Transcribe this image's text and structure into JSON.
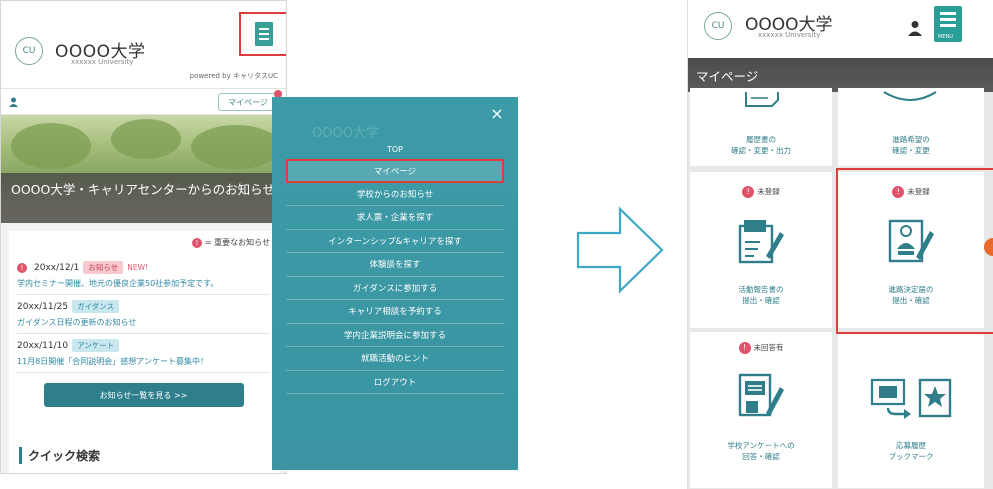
{
  "left": {
    "logo_mark": "CU",
    "university_name": "OOOO大学",
    "university_sub": "xxxxxx University",
    "powered_by": "powered by キャリタスUC",
    "mypage_button": "マイページ",
    "hero_title": "OOOO大学・キャリアセンターからのお知らせ",
    "legend": "= 重要なお知らせ",
    "news": [
      {
        "date": "20xx/12/1",
        "tag": "お知らせ",
        "tag_type": "notice",
        "new": "NEW!",
        "important": true,
        "title": "学内セミナー開催、地元の優良企業50社参加予定です。"
      },
      {
        "date": "20xx/11/25",
        "tag": "ガイダンス",
        "tag_type": "guide",
        "new": "",
        "important": false,
        "title": "ガイダンス日程の更新のお知らせ"
      },
      {
        "date": "20xx/11/10",
        "tag": "アンケート",
        "tag_type": "survey",
        "new": "",
        "important": false,
        "title": "11月8日開催「合同説明会」感想アンケート募集中！"
      }
    ],
    "more_button": "お知らせ一覧を見る >>",
    "quick_search": "クイック検索"
  },
  "menu": {
    "ghost_title": "OOOO大学",
    "close_label": "×",
    "top_label": "TOP",
    "items": [
      "マイページ",
      "学校からのお知らせ",
      "求人票・企業を探す",
      "インターンシップ&キャリアを探す",
      "体験談を探す",
      "ガイダンスに参加する",
      "キャリア相談を予約する",
      "学内企業説明会に参加する",
      "就職活動のヒント",
      "ログアウト"
    ],
    "highlight_index": 0
  },
  "right": {
    "logo_mark": "CU",
    "university_name": "OOOO大学",
    "university_sub": "xxxxxx University",
    "menu_caption": "MENU",
    "banner_title": "マイページ",
    "cards": [
      {
        "label1": "履歴書の",
        "label2": "確認・変更・出力",
        "badge": "",
        "icon": "resume-icon"
      },
      {
        "label1": "進路希望の",
        "label2": "確認・変更",
        "badge": "",
        "icon": "speech-bubble-icon"
      },
      {
        "label1": "活動報告書の",
        "label2": "提出・確認",
        "badge": "未登録",
        "icon": "report-icon"
      },
      {
        "label1": "進路決定届の",
        "label2": "提出・確認",
        "badge": "未登録",
        "icon": "decision-report-icon"
      },
      {
        "label1": "学校アンケートへの",
        "label2": "回答・確認",
        "badge": "未回答有",
        "icon": "survey-icon"
      },
      {
        "label1": "応募履歴",
        "label2": "ブックマーク",
        "badge": "",
        "icon": "bookmark-icon"
      }
    ]
  },
  "colors": {
    "teal": "#3a9e99",
    "teal_dark": "#2e7f8b",
    "highlight_red": "#e03c3c",
    "alert_pink": "#e0546b",
    "menu_bg": "#3c9ba7"
  }
}
